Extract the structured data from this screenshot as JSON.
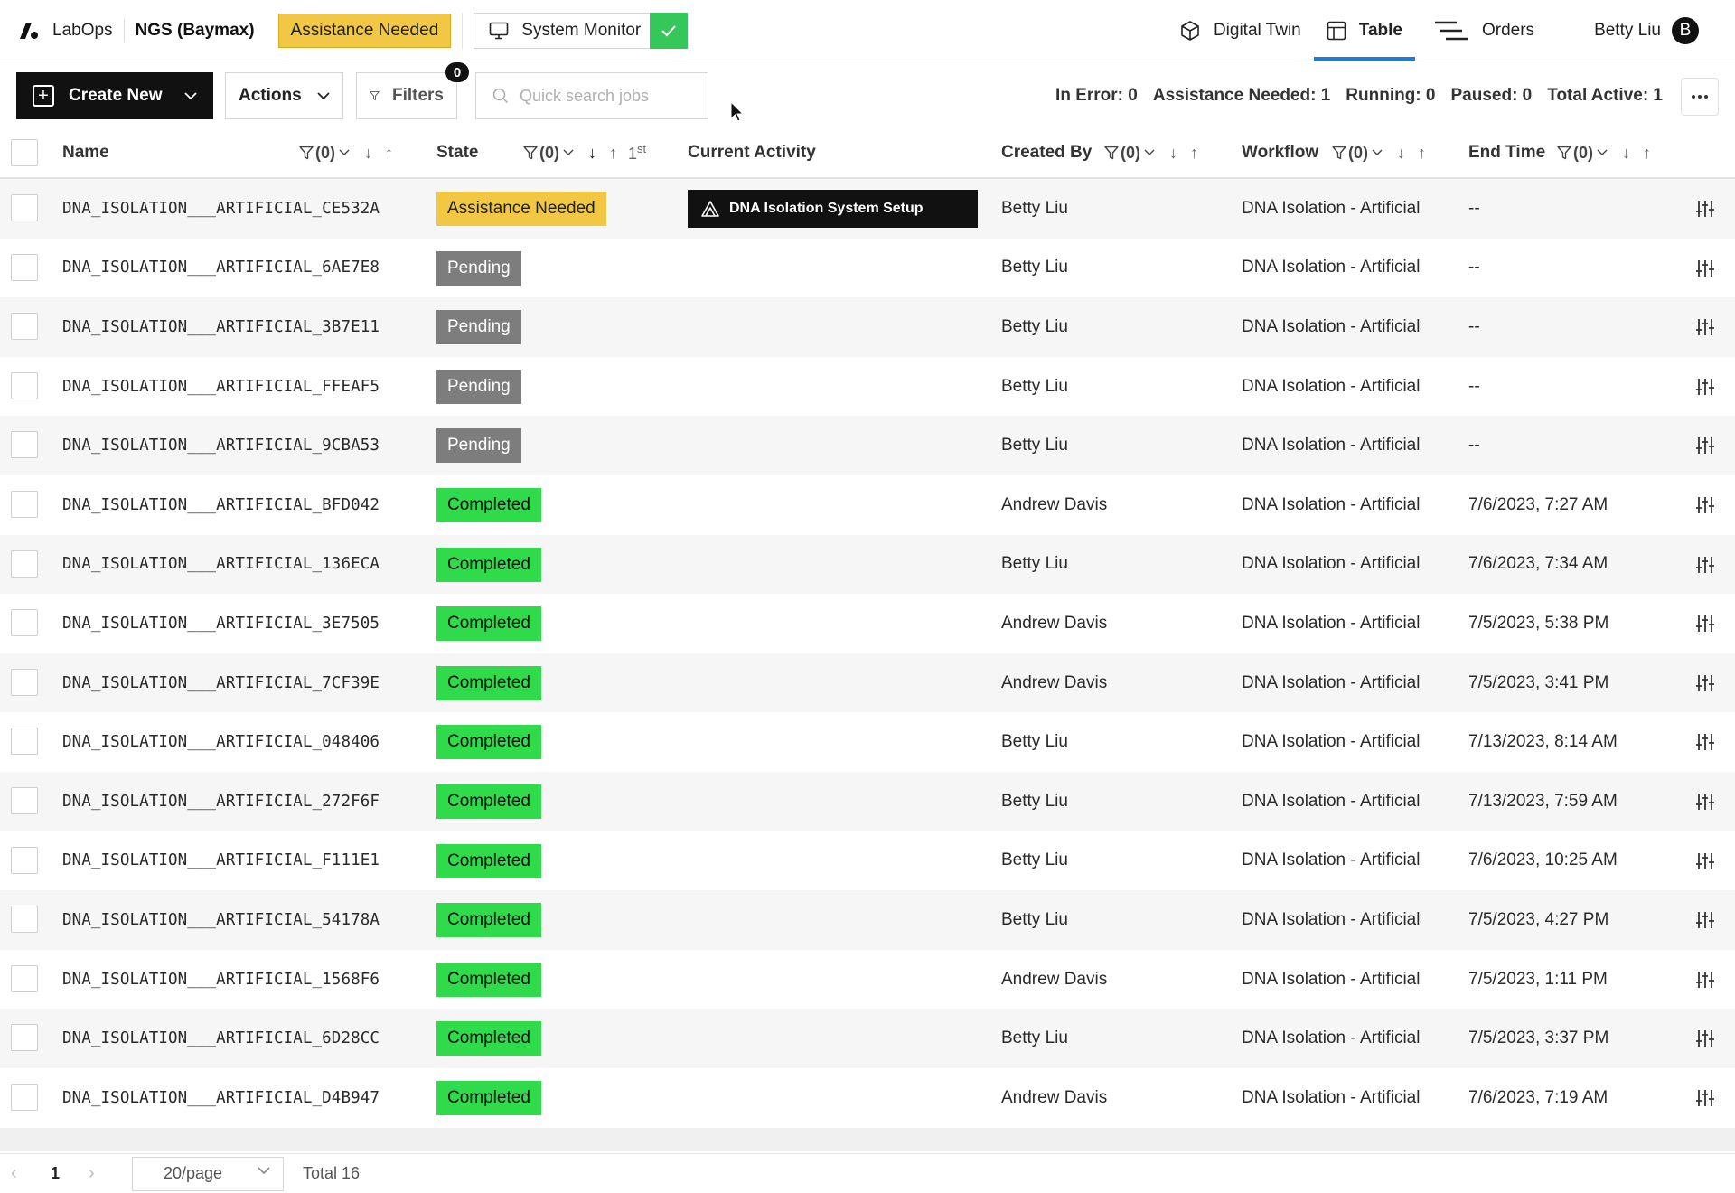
{
  "nav": {
    "brand": "LabOps",
    "instrument": "NGS (Baymax)",
    "alert_badge": "Assistance Needed",
    "system_monitor": "System Monitor",
    "tabs": [
      {
        "label": "Digital Twin",
        "icon": "cube-icon"
      },
      {
        "label": "Table",
        "icon": "table-icon",
        "active": true
      },
      {
        "label": "Orders",
        "icon": "list-lines-icon"
      }
    ],
    "user_name": "Betty Liu",
    "user_initial": "B"
  },
  "toolbar": {
    "create_label": "Create New",
    "actions_label": "Actions",
    "filters_label": "Filters",
    "filters_count": "0",
    "search_placeholder": "Quick search jobs"
  },
  "stats": {
    "in_error": "In Error: 0",
    "assistance_needed": "Assistance Needed: 1",
    "running": "Running: 0",
    "paused": "Paused: 0",
    "total_active": "Total Active: 1"
  },
  "columns": {
    "name": "Name",
    "state": "State",
    "current_activity": "Current Activity",
    "created_by": "Created By",
    "workflow": "Workflow",
    "end_time": "End Time",
    "filter_count": "(0)",
    "sort_priority": "1",
    "sort_priority_suffix": "st"
  },
  "rows": [
    {
      "name": "DNA_ISOLATION___ARTIFICIAL_CE532A",
      "state": "Assistance Needed",
      "state_kind": "assist",
      "activity": "DNA Isolation System Setup",
      "created_by": "Betty Liu",
      "workflow": "DNA Isolation - Artificial",
      "end_time": "--"
    },
    {
      "name": "DNA_ISOLATION___ARTIFICIAL_6AE7E8",
      "state": "Pending",
      "state_kind": "pending",
      "activity": "",
      "created_by": "Betty Liu",
      "workflow": "DNA Isolation - Artificial",
      "end_time": "--"
    },
    {
      "name": "DNA_ISOLATION___ARTIFICIAL_3B7E11",
      "state": "Pending",
      "state_kind": "pending",
      "activity": "",
      "created_by": "Betty Liu",
      "workflow": "DNA Isolation - Artificial",
      "end_time": "--"
    },
    {
      "name": "DNA_ISOLATION___ARTIFICIAL_FFEAF5",
      "state": "Pending",
      "state_kind": "pending",
      "activity": "",
      "created_by": "Betty Liu",
      "workflow": "DNA Isolation - Artificial",
      "end_time": "--"
    },
    {
      "name": "DNA_ISOLATION___ARTIFICIAL_9CBA53",
      "state": "Pending",
      "state_kind": "pending",
      "activity": "",
      "created_by": "Betty Liu",
      "workflow": "DNA Isolation - Artificial",
      "end_time": "--"
    },
    {
      "name": "DNA_ISOLATION___ARTIFICIAL_BFD042",
      "state": "Completed",
      "state_kind": "completed",
      "activity": "",
      "created_by": "Andrew Davis",
      "workflow": "DNA Isolation - Artificial",
      "end_time": "7/6/2023, 7:27 AM"
    },
    {
      "name": "DNA_ISOLATION___ARTIFICIAL_136ECA",
      "state": "Completed",
      "state_kind": "completed",
      "activity": "",
      "created_by": "Betty Liu",
      "workflow": "DNA Isolation - Artificial",
      "end_time": "7/6/2023, 7:34 AM"
    },
    {
      "name": "DNA_ISOLATION___ARTIFICIAL_3E7505",
      "state": "Completed",
      "state_kind": "completed",
      "activity": "",
      "created_by": "Andrew Davis",
      "workflow": "DNA Isolation - Artificial",
      "end_time": "7/5/2023, 5:38 PM"
    },
    {
      "name": "DNA_ISOLATION___ARTIFICIAL_7CF39E",
      "state": "Completed",
      "state_kind": "completed",
      "activity": "",
      "created_by": "Andrew Davis",
      "workflow": "DNA Isolation - Artificial",
      "end_time": "7/5/2023, 3:41 PM"
    },
    {
      "name": "DNA_ISOLATION___ARTIFICIAL_048406",
      "state": "Completed",
      "state_kind": "completed",
      "activity": "",
      "created_by": "Betty Liu",
      "workflow": "DNA Isolation - Artificial",
      "end_time": "7/13/2023, 8:14 AM"
    },
    {
      "name": "DNA_ISOLATION___ARTIFICIAL_272F6F",
      "state": "Completed",
      "state_kind": "completed",
      "activity": "",
      "created_by": "Betty Liu",
      "workflow": "DNA Isolation - Artificial",
      "end_time": "7/13/2023, 7:59 AM"
    },
    {
      "name": "DNA_ISOLATION___ARTIFICIAL_F111E1",
      "state": "Completed",
      "state_kind": "completed",
      "activity": "",
      "created_by": "Betty Liu",
      "workflow": "DNA Isolation - Artificial",
      "end_time": "7/6/2023, 10:25 AM"
    },
    {
      "name": "DNA_ISOLATION___ARTIFICIAL_54178A",
      "state": "Completed",
      "state_kind": "completed",
      "activity": "",
      "created_by": "Betty Liu",
      "workflow": "DNA Isolation - Artificial",
      "end_time": "7/5/2023, 4:27 PM"
    },
    {
      "name": "DNA_ISOLATION___ARTIFICIAL_1568F6",
      "state": "Completed",
      "state_kind": "completed",
      "activity": "",
      "created_by": "Andrew Davis",
      "workflow": "DNA Isolation - Artificial",
      "end_time": "7/5/2023, 1:11 PM"
    },
    {
      "name": "DNA_ISOLATION___ARTIFICIAL_6D28CC",
      "state": "Completed",
      "state_kind": "completed",
      "activity": "",
      "created_by": "Betty Liu",
      "workflow": "DNA Isolation - Artificial",
      "end_time": "7/5/2023, 3:37 PM"
    },
    {
      "name": "DNA_ISOLATION___ARTIFICIAL_D4B947",
      "state": "Completed",
      "state_kind": "completed",
      "activity": "",
      "created_by": "Andrew Davis",
      "workflow": "DNA Isolation - Artificial",
      "end_time": "7/6/2023, 7:19 AM"
    }
  ],
  "pagination": {
    "current_page": "1",
    "page_size": "20/page",
    "total": "Total 16"
  },
  "colors": {
    "assist": "#f2c744",
    "pending": "#7d7d7d",
    "completed": "#2fdb4a",
    "monitor_ok": "#35c759",
    "active_tab_underline": "#1f7ae0"
  }
}
